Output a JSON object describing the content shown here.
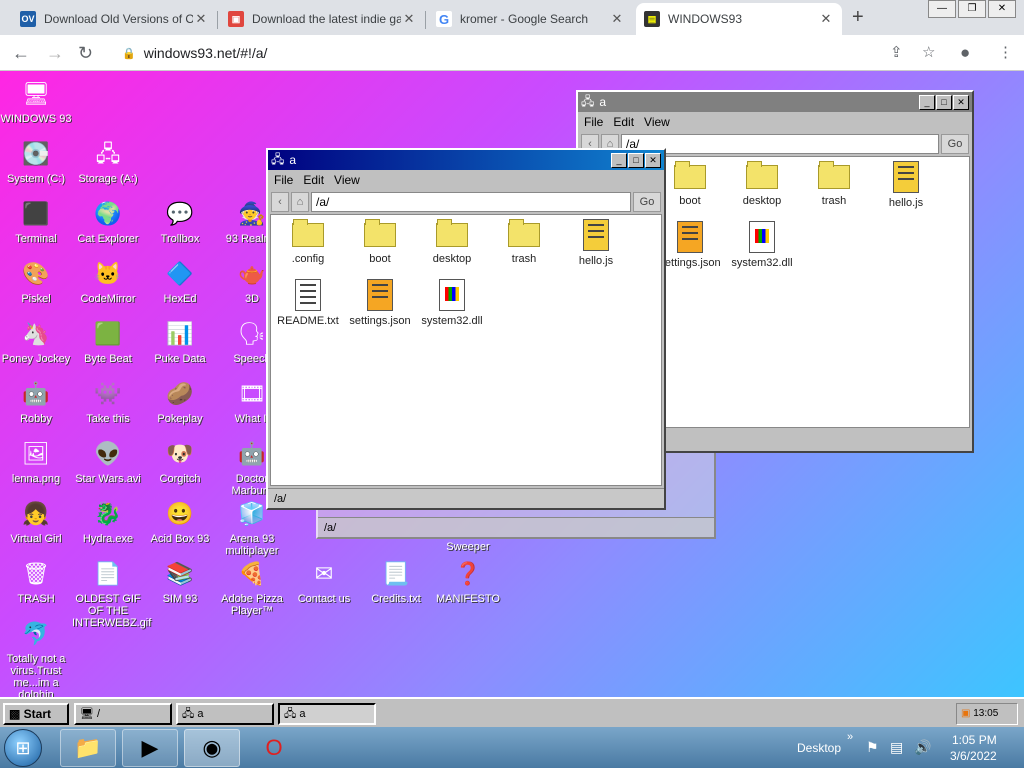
{
  "browser": {
    "tabs": [
      {
        "title": "Download Old Versions of Opera",
        "favicon": "OV",
        "fav_color": "#1f5fa8"
      },
      {
        "title": "Download the latest indie games",
        "favicon": "▣",
        "fav_color": "#e0463e"
      },
      {
        "title": "kromer - Google Search",
        "favicon": "G",
        "fav_color": "#4285f4"
      },
      {
        "title": "WINDOWS93",
        "favicon": "▤",
        "fav_color": "#1c1c1c"
      }
    ],
    "url": "windows93.net/#!/a/"
  },
  "desktop_icons": [
    {
      "label": "WINDOWS 93",
      "icon": "🖥"
    },
    {
      "label": "System (C:)",
      "icon": "💽"
    },
    {
      "label": "Storage (A:)",
      "icon": "🖧"
    },
    {
      "label": "Terminal",
      "icon": "⬛"
    },
    {
      "label": "Cat Explorer",
      "icon": "🌍"
    },
    {
      "label": "Trollbox",
      "icon": "💬"
    },
    {
      "label": "93 Realms",
      "icon": "🧙"
    },
    {
      "label": "Piskel",
      "icon": "🎨"
    },
    {
      "label": "CodeMirror",
      "icon": "🐱"
    },
    {
      "label": "HexEd",
      "icon": "🔷"
    },
    {
      "label": "3D",
      "icon": "🫖"
    },
    {
      "label": "Poney Jockey",
      "icon": "🦄"
    },
    {
      "label": "Byte Beat",
      "icon": "🟩"
    },
    {
      "label": "Puke Data",
      "icon": "📊"
    },
    {
      "label": "Speech",
      "icon": "🗣"
    },
    {
      "label": "Robby",
      "icon": "🤖"
    },
    {
      "label": "Take this",
      "icon": "👾"
    },
    {
      "label": "Pokeplay",
      "icon": "🥔"
    },
    {
      "label": "What If",
      "icon": "🎞"
    },
    {
      "label": "lenna.png",
      "icon": "🖼"
    },
    {
      "label": "Star Wars.avi",
      "icon": "👽"
    },
    {
      "label": "Corgitch",
      "icon": "🐶"
    },
    {
      "label": "Doctor Marburg",
      "icon": "🤖"
    },
    {
      "label": "Virtual Girl",
      "icon": "👧"
    },
    {
      "label": "Hydra.exe",
      "icon": "🐉"
    },
    {
      "label": "Acid Box 93",
      "icon": "😀"
    },
    {
      "label": "Arena 93 multiplayer",
      "icon": "🧊"
    },
    {
      "label": "TRASH",
      "icon": "🗑"
    },
    {
      "label": "OLDEST GIF OF THE INTERWEBZ.gif",
      "icon": "📄"
    },
    {
      "label": "SIM 93",
      "icon": "📚"
    },
    {
      "label": "Adobe Pizza Player™",
      "icon": "🍕"
    },
    {
      "label": "Contact us",
      "icon": "✉"
    },
    {
      "label": "Credits.txt",
      "icon": "📃"
    },
    {
      "label": "MANIFESTO",
      "icon": "❓"
    },
    {
      "label": "Totally not a virus.Trust me...im a dolphin",
      "icon": "🐬"
    },
    {
      "label": "Sweeper",
      "icon": ""
    }
  ],
  "window_back": {
    "title": "a",
    "menu": [
      "File",
      "Edit",
      "View"
    ],
    "path": "/a/",
    "go": "Go",
    "status": "/a/",
    "files": [
      {
        "name": "boot",
        "type": "folder"
      },
      {
        "name": "desktop",
        "type": "folder"
      },
      {
        "name": "trash",
        "type": "folder"
      },
      {
        "name": "hello.js",
        "type": "js"
      },
      {
        "name": "settings.json",
        "type": "json"
      },
      {
        "name": "system32.dll",
        "type": "dll"
      }
    ]
  },
  "window_front": {
    "title": "a",
    "menu": [
      "File",
      "Edit",
      "View"
    ],
    "path": "/a/",
    "go": "Go",
    "status": "/a/",
    "files": [
      {
        "name": ".config",
        "type": "folder"
      },
      {
        "name": "boot",
        "type": "folder"
      },
      {
        "name": "desktop",
        "type": "folder"
      },
      {
        "name": "trash",
        "type": "folder"
      },
      {
        "name": "hello.js",
        "type": "js"
      },
      {
        "name": "README.txt",
        "type": "txt"
      },
      {
        "name": "settings.json",
        "type": "json"
      },
      {
        "name": "system32.dll",
        "type": "dll"
      }
    ]
  },
  "window_third": {
    "status": "/a/"
  },
  "taskbar93": {
    "start": "Start",
    "items": [
      "/",
      "a",
      "a"
    ],
    "clock": "13:05"
  },
  "win7": {
    "desktop_label": "Desktop",
    "time": "1:05 PM",
    "date": "3/6/2022"
  },
  "colors": {
    "title_active": "#000080",
    "title_inactive": "#808080"
  }
}
